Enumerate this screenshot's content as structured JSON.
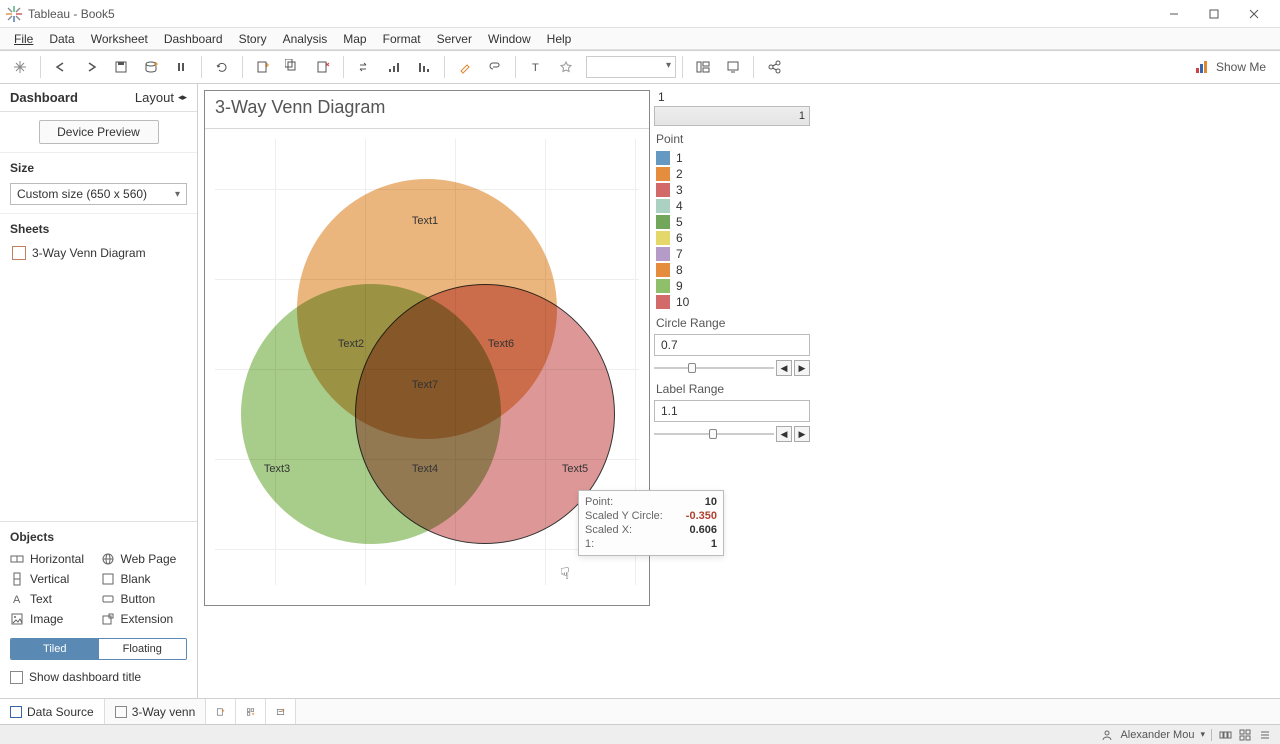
{
  "window": {
    "title": "Tableau - Book5"
  },
  "menu": [
    "File",
    "Data",
    "Worksheet",
    "Dashboard",
    "Story",
    "Analysis",
    "Map",
    "Format",
    "Server",
    "Window",
    "Help"
  ],
  "side": {
    "tabs": {
      "active": "Dashboard",
      "other": "Layout"
    },
    "device_preview": "Device Preview",
    "size_label": "Size",
    "size_value": "Custom size (650 x 560)",
    "sheets_label": "Sheets",
    "sheets": [
      "3-Way Venn Diagram"
    ],
    "objects_label": "Objects",
    "objects": [
      "Horizontal",
      "Web Page",
      "Vertical",
      "Blank",
      "Text",
      "Button",
      "Image",
      "Extension"
    ],
    "tiled": "Tiled",
    "floating": "Floating",
    "show_title": "Show dashboard title"
  },
  "viz": {
    "title": "3-Way Venn Diagram",
    "labels": [
      "Text1",
      "Text2",
      "Text3",
      "Text4",
      "Text5",
      "Text6",
      "Text7"
    ]
  },
  "controls": {
    "top_label": "1",
    "top_value": "1",
    "point_label": "Point",
    "legend": [
      {
        "n": "1",
        "c": "#6699c2"
      },
      {
        "n": "2",
        "c": "#e58d3f"
      },
      {
        "n": "3",
        "c": "#d36a6a"
      },
      {
        "n": "4",
        "c": "#aad1c1"
      },
      {
        "n": "5",
        "c": "#72a65a"
      },
      {
        "n": "6",
        "c": "#e5d86a"
      },
      {
        "n": "7",
        "c": "#b49bc8"
      },
      {
        "n": "8",
        "c": "#e58d3f"
      },
      {
        "n": "9",
        "c": "#8fbf6a"
      },
      {
        "n": "10",
        "c": "#d36a6a"
      }
    ],
    "circle_range_label": "Circle Range",
    "circle_range_value": "0.7",
    "label_range_label": "Label Range",
    "label_range_value": "1.1"
  },
  "tooltip": {
    "rows": [
      {
        "k": "Point:",
        "v": "10"
      },
      {
        "k": "Scaled Y Circle:",
        "v": "-0.350",
        "neg": true
      },
      {
        "k": "Scaled X:",
        "v": "0.606"
      },
      {
        "k": "1:",
        "v": "1"
      }
    ]
  },
  "tabs": {
    "data_source": "Data Source",
    "sheet": "3-Way venn"
  },
  "status": {
    "user": "Alexander Mou"
  },
  "showme": "Show Me",
  "chart_data": {
    "type": "venn3",
    "title": "3-Way Venn Diagram",
    "circles": [
      {
        "id": "A",
        "color": "#e6a259",
        "cx": 0.49,
        "cy": 0.34,
        "r": 0.29,
        "label": "Text1"
      },
      {
        "id": "B",
        "color": "#8fbf6a",
        "cx": 0.38,
        "cy": 0.56,
        "r": 0.29,
        "label": "Text3"
      },
      {
        "id": "C",
        "color": "#d47a7a",
        "cx": 0.6,
        "cy": 0.56,
        "r": 0.29,
        "label": "Text5",
        "outlined": true
      }
    ],
    "region_labels": {
      "AB": "Text2",
      "BC": "Text4",
      "AC": "Text6",
      "ABC": "Text7"
    },
    "parameters": {
      "circle_range": 0.7,
      "label_range": 1.1
    },
    "hover_point": {
      "Point": 10,
      "Scaled_Y_Circle": -0.35,
      "Scaled_X": 0.606,
      "series_1": 1
    }
  }
}
